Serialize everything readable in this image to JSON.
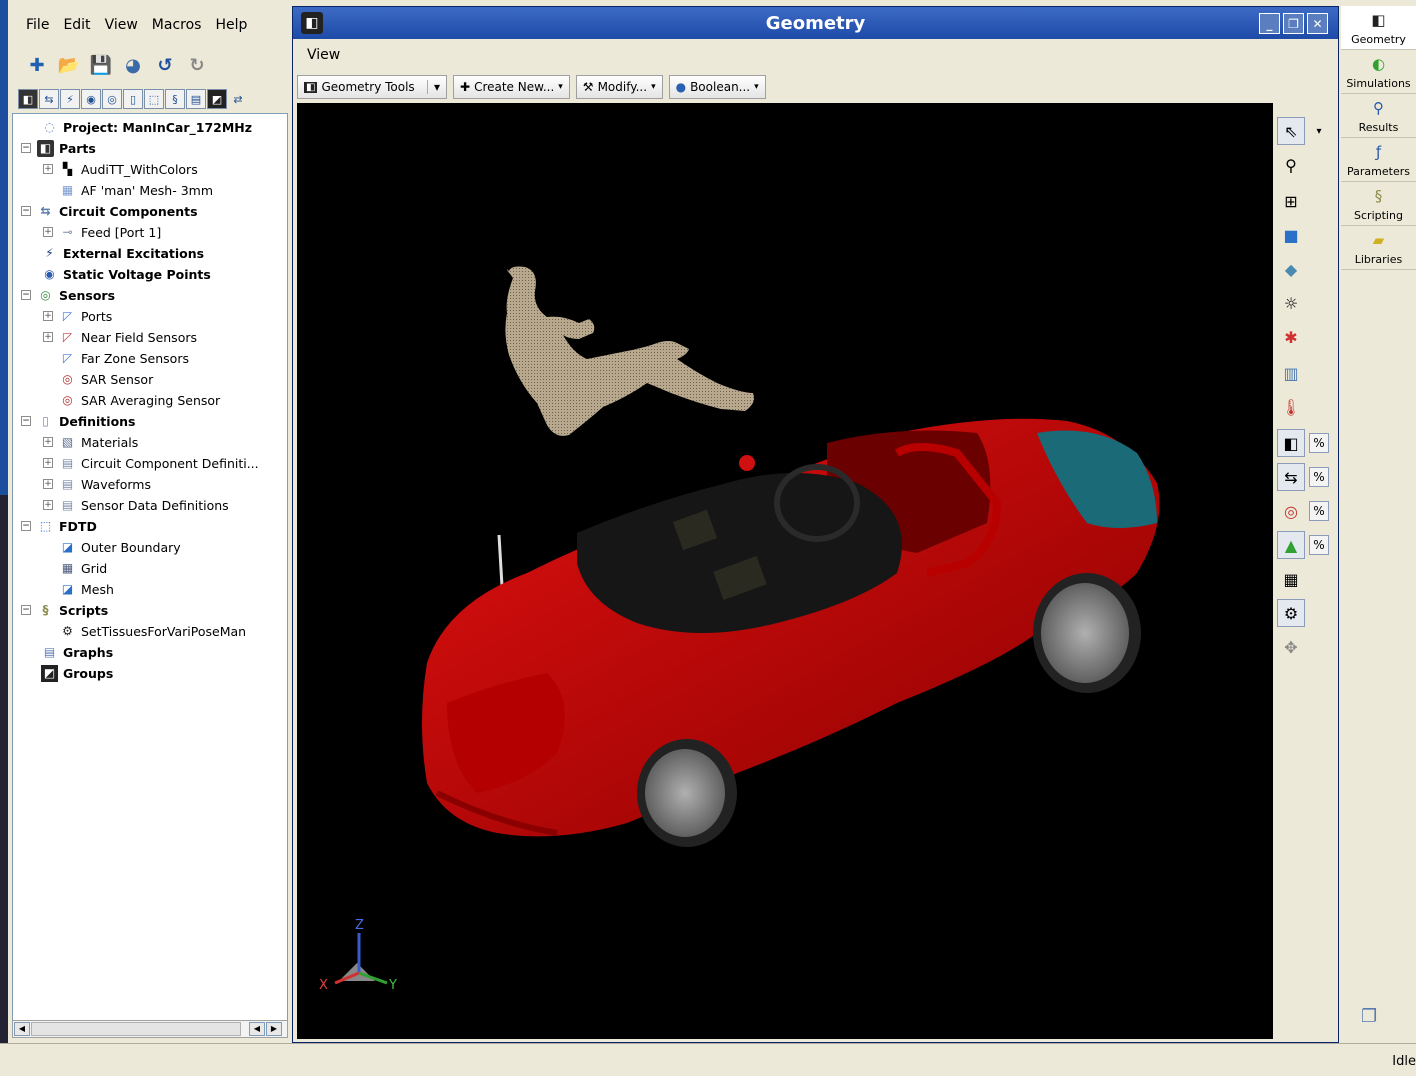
{
  "menubar": {
    "file": "File",
    "edit": "Edit",
    "view": "View",
    "macros": "Macros",
    "help": "Help"
  },
  "window": {
    "title": "Geometry",
    "view_menu": "View",
    "minimize": "_",
    "restore": "❐",
    "close": "✕"
  },
  "toolbar": {
    "geometry_tools": "Geometry Tools",
    "create_new": "Create New...",
    "modify": "Modify...",
    "boolean": "Boolean..."
  },
  "tree": {
    "project": "Project: ManInCar_172MHz",
    "parts": "Parts",
    "audi": "AudiTT_WithColors",
    "man_mesh": "AF 'man' Mesh- 3mm",
    "circuit_components": "Circuit Components",
    "feed": "Feed [Port 1]",
    "external_excitations": "External Excitations",
    "static_voltage": "Static Voltage Points",
    "sensors": "Sensors",
    "ports": "Ports",
    "near_field": "Near Field Sensors",
    "far_zone": "Far Zone Sensors",
    "sar_sensor": "SAR Sensor",
    "sar_avg": "SAR Averaging Sensor",
    "definitions": "Definitions",
    "materials": "Materials",
    "circuit_defs": "Circuit Component Definiti...",
    "waveforms": "Waveforms",
    "sensor_data": "Sensor Data Definitions",
    "fdtd": "FDTD",
    "outer_boundary": "Outer Boundary",
    "grid": "Grid",
    "mesh": "Mesh",
    "scripts": "Scripts",
    "set_tissues": "SetTissuesForVariPoseMan",
    "graphs": "Graphs",
    "groups": "Groups"
  },
  "axes": {
    "x": "X",
    "y": "Y",
    "z": "Z"
  },
  "side_nav": {
    "geometry": "Geometry",
    "simulations": "Simulations",
    "results": "Results",
    "parameters": "Parameters",
    "scripting": "Scripting",
    "libraries": "Libraries"
  },
  "status": {
    "text": "Idle"
  },
  "colors": {
    "title_bar": "#2a56b4",
    "car_red": "#c80000",
    "viewport_bg": "#000000",
    "figure": "#b8a98e"
  }
}
